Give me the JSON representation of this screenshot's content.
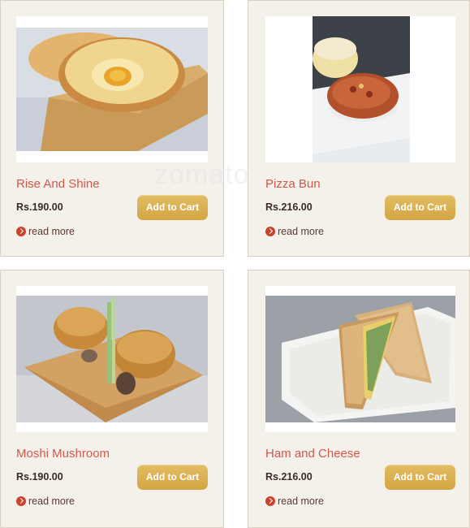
{
  "products": [
    {
      "name": "Rise And Shine",
      "price": "Rs.190.00",
      "cart_label": "Add to Cart",
      "read_more": "read more",
      "image": "egg-toast-photo"
    },
    {
      "name": "Pizza Bun",
      "price": "Rs.216.00",
      "cart_label": "Add to Cart",
      "read_more": "read more",
      "image": "pizza-bun-photo"
    },
    {
      "name": "Moshi Mushroom",
      "price": "Rs.190.00",
      "cart_label": "Add to Cart",
      "read_more": "read more",
      "image": "mushroom-bun-photo"
    },
    {
      "name": "Ham and Cheese",
      "price": "Rs.216.00",
      "cart_label": "Add to Cart",
      "read_more": "read more",
      "image": "sandwich-photo"
    }
  ],
  "watermark": "zomato",
  "colors": {
    "card_bg": "#f4f1eb",
    "title": "#d2574a",
    "button": "#d9ae50",
    "read_more_icon": "#c9432f"
  }
}
